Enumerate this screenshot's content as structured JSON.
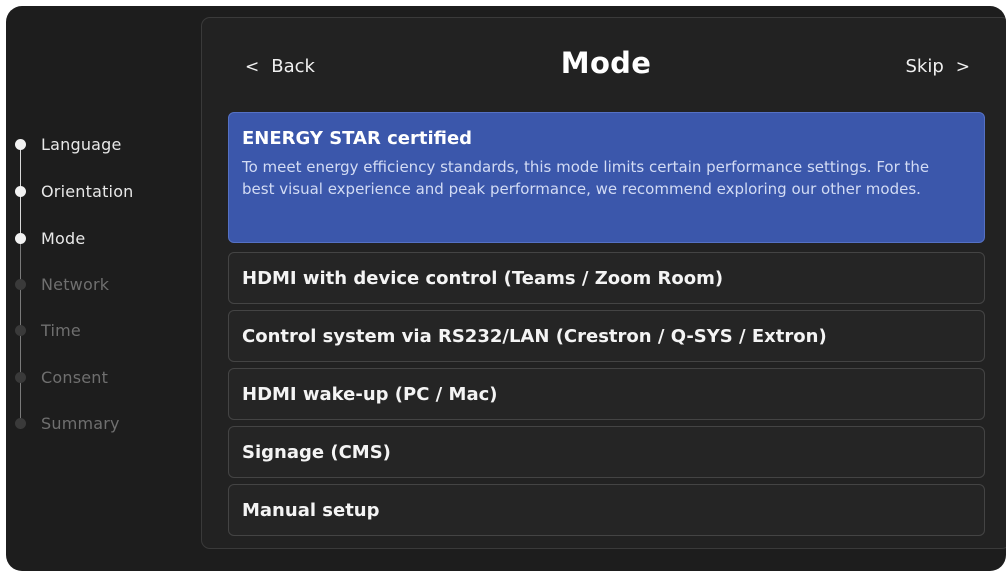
{
  "steps": [
    {
      "label": "Language",
      "state": "done"
    },
    {
      "label": "Orientation",
      "state": "done"
    },
    {
      "label": "Mode",
      "state": "current"
    },
    {
      "label": "Network",
      "state": "pending"
    },
    {
      "label": "Time",
      "state": "pending"
    },
    {
      "label": "Consent",
      "state": "pending"
    },
    {
      "label": "Summary",
      "state": "pending"
    }
  ],
  "header": {
    "back_label": "Back",
    "title": "Mode",
    "skip_label": "Skip",
    "back_icon": "chevron-left-icon",
    "skip_icon": "chevron-right-icon"
  },
  "selected_option": {
    "title": "ENERGY STAR certified",
    "description": "To meet energy efficiency standards, this mode limits certain performance settings. For the best visual experience and peak performance, we recommend exploring our other modes."
  },
  "options": [
    "HDMI with device control (Teams / Zoom Room)",
    "Control system via RS232/LAN (Crestron / Q-SYS / Extron)",
    "HDMI wake-up (PC / Mac)",
    "Signage (CMS)",
    "Manual setup"
  ],
  "colors": {
    "background": "#1d1d1d",
    "panel": "#222222",
    "selected": "#3b57ab",
    "text": "#f0f0f0",
    "muted": "#6f6f6f"
  }
}
